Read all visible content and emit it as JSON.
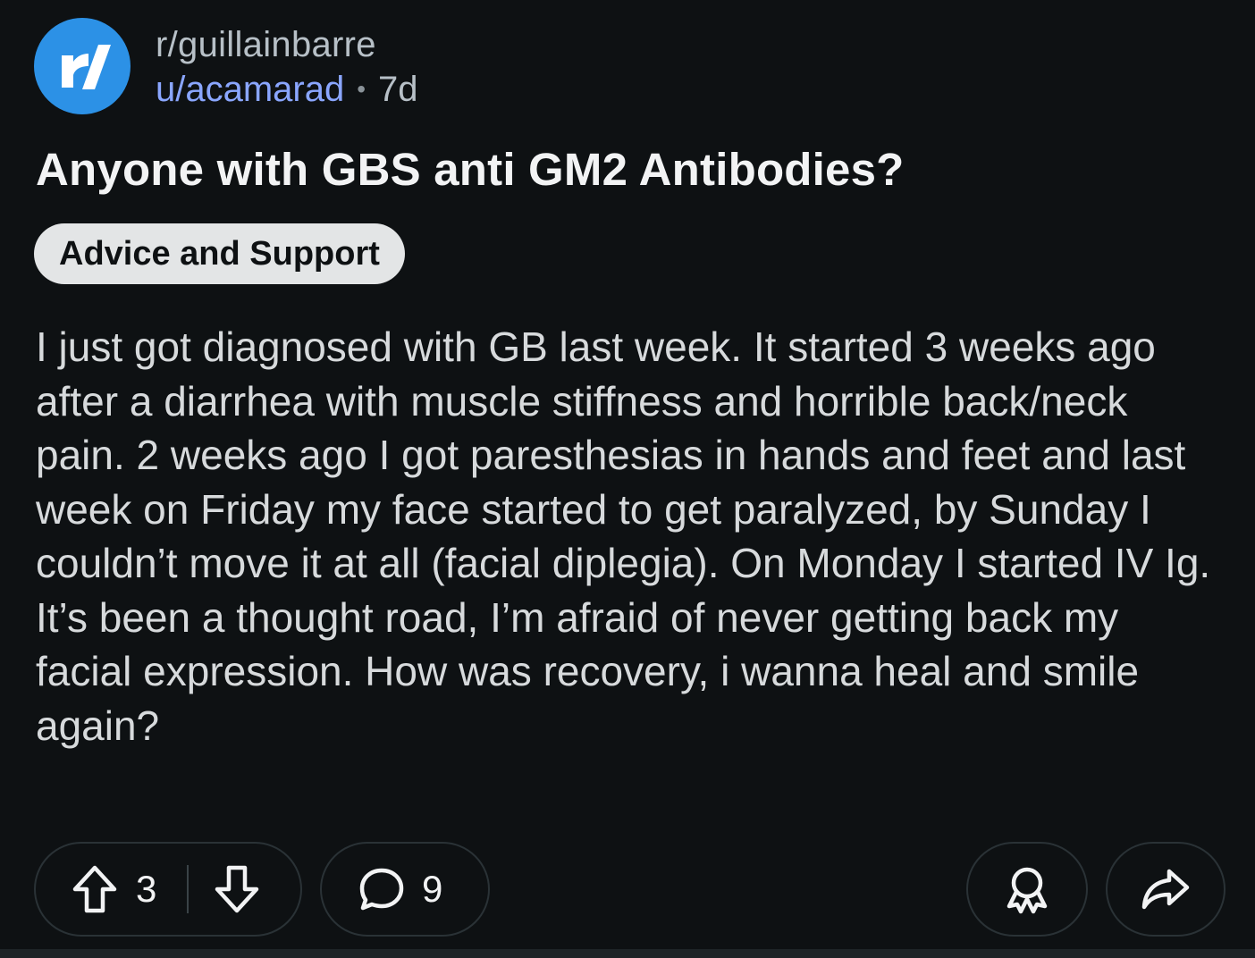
{
  "post": {
    "subreddit": "r/guillainbarre",
    "author": "u/acamarad",
    "separator": "•",
    "age": "7d",
    "title": "Anyone with GBS anti GM2 Antibodies?",
    "flair": "Advice and Support",
    "body": "I just got diagnosed with GB last week. It started 3 weeks ago after a diarrhea with muscle stiffness and horrible back/neck pain. 2 weeks ago I got paresthesias in hands and feet and last week on Friday my face started to get paralyzed, by Sunday I couldn’t move it at all (facial diplegia). On Monday I started IV Ig. It’s been a thought road, I’m afraid of never getting back my facial expression. How was recovery, i wanna heal and smile again?"
  },
  "actions": {
    "upvote_count": "3",
    "comment_count": "9",
    "icons": {
      "upvote": "upvote-arrow-icon",
      "downvote": "downvote-arrow-icon",
      "comment": "comment-bubble-icon",
      "award": "award-icon",
      "share": "share-arrow-icon"
    }
  },
  "colors": {
    "background": "#0e1113",
    "avatar": "#2c91e6",
    "username": "#8aa6ff",
    "flair_bg": "#e3e5e6",
    "pill_border": "#2a3236"
  }
}
